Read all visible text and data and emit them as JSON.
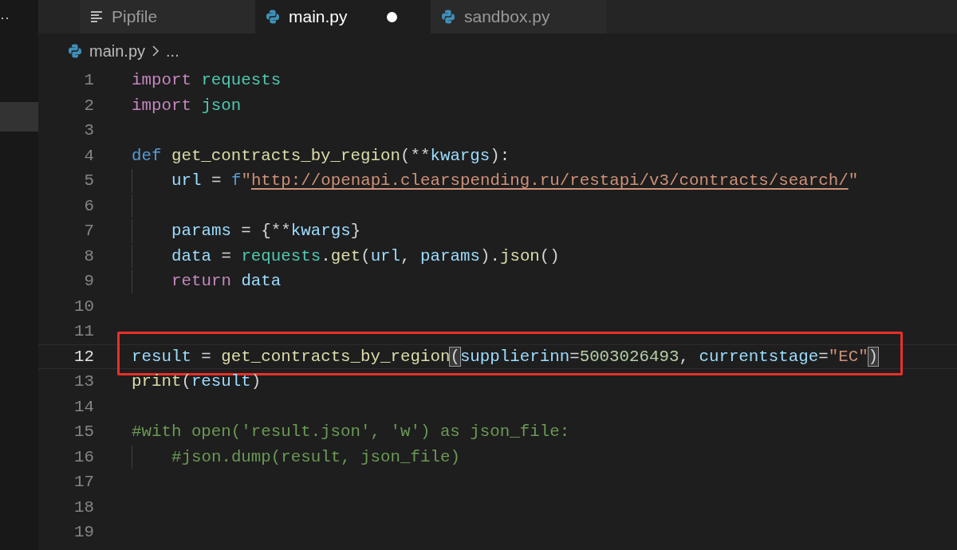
{
  "tab_overflow": "··",
  "tabs": [
    {
      "label": "Pipfile",
      "kind": "text",
      "selected": false,
      "modified": false
    },
    {
      "label": "main.py",
      "kind": "python",
      "selected": true,
      "modified": true
    },
    {
      "label": "sandbox.py",
      "kind": "python",
      "selected": false,
      "modified": false
    }
  ],
  "breadcrumb": {
    "file": "main.py",
    "rest": "..."
  },
  "lines": [
    {
      "number": "1",
      "current": false,
      "boxed": false,
      "indent_guide": false,
      "tokens": [
        {
          "kind": "keyword",
          "text": "import "
        },
        {
          "kind": "module",
          "text": "requests"
        }
      ]
    },
    {
      "number": "2",
      "current": false,
      "boxed": false,
      "indent_guide": false,
      "tokens": [
        {
          "kind": "keyword",
          "text": "import "
        },
        {
          "kind": "module",
          "text": "json"
        }
      ]
    },
    {
      "number": "3",
      "current": false,
      "boxed": false,
      "indent_guide": false
    },
    {
      "number": "4",
      "current": false,
      "boxed": false,
      "indent_guide": false,
      "tokens": [
        {
          "kind": "storage",
          "text": "def "
        },
        {
          "kind": "function",
          "text": "get_contracts_by_region"
        },
        {
          "kind": "plain",
          "text": "(**"
        },
        {
          "kind": "variable",
          "text": "kwargs"
        },
        {
          "kind": "plain",
          "text": "):"
        }
      ]
    },
    {
      "number": "5",
      "current": false,
      "boxed": false,
      "indent_guide": true,
      "tokens": [
        {
          "kind": "variable",
          "text": "url"
        },
        {
          "kind": "plain",
          "text": " = "
        },
        {
          "kind": "storage",
          "text": "f"
        },
        {
          "kind": "string",
          "text": "\""
        },
        {
          "kind": "link",
          "text": "http://openapi.clearspending.ru/restapi/v3/contracts/search/"
        },
        {
          "kind": "string",
          "text": "\""
        }
      ]
    },
    {
      "number": "6",
      "current": false,
      "boxed": false,
      "indent_guide": true
    },
    {
      "number": "7",
      "current": false,
      "boxed": false,
      "indent_guide": true,
      "tokens": [
        {
          "kind": "variable",
          "text": "params"
        },
        {
          "kind": "plain",
          "text": " = {**"
        },
        {
          "kind": "variable",
          "text": "kwargs"
        },
        {
          "kind": "plain",
          "text": "}"
        }
      ]
    },
    {
      "number": "8",
      "current": false,
      "boxed": false,
      "indent_guide": true,
      "tokens": [
        {
          "kind": "variable",
          "text": "data"
        },
        {
          "kind": "plain",
          "text": " = "
        },
        {
          "kind": "module",
          "text": "requests"
        },
        {
          "kind": "plain",
          "text": "."
        },
        {
          "kind": "function",
          "text": "get"
        },
        {
          "kind": "plain",
          "text": "("
        },
        {
          "kind": "variable",
          "text": "url"
        },
        {
          "kind": "plain",
          "text": ", "
        },
        {
          "kind": "variable",
          "text": "params"
        },
        {
          "kind": "plain",
          "text": ")."
        },
        {
          "kind": "function",
          "text": "json"
        },
        {
          "kind": "plain",
          "text": "()"
        }
      ]
    },
    {
      "number": "9",
      "current": false,
      "boxed": false,
      "indent_guide": true,
      "tokens": [
        {
          "kind": "keyword",
          "text": "return "
        },
        {
          "kind": "variable",
          "text": "data"
        }
      ]
    },
    {
      "number": "10",
      "current": false,
      "boxed": false,
      "indent_guide": false
    },
    {
      "number": "11",
      "current": false,
      "boxed": false,
      "indent_guide": false
    },
    {
      "number": "12",
      "current": true,
      "boxed": true,
      "indent_guide": false,
      "tokens": [
        {
          "kind": "variable",
          "text": "result"
        },
        {
          "kind": "plain",
          "text": " = "
        },
        {
          "kind": "function",
          "text": "get_contracts_by_region"
        },
        {
          "kind": "bracket-match",
          "text": "("
        },
        {
          "kind": "variable",
          "text": "supplierinn"
        },
        {
          "kind": "plain",
          "text": "="
        },
        {
          "kind": "number",
          "text": "5003026493"
        },
        {
          "kind": "plain",
          "text": ", "
        },
        {
          "kind": "variable",
          "text": "currentstage"
        },
        {
          "kind": "plain",
          "text": "="
        },
        {
          "kind": "string",
          "text": "\"EC\""
        },
        {
          "kind": "bracket-match",
          "text": ")"
        }
      ]
    },
    {
      "number": "13",
      "current": false,
      "boxed": false,
      "indent_guide": false,
      "tokens": [
        {
          "kind": "function",
          "text": "print"
        },
        {
          "kind": "plain",
          "text": "("
        },
        {
          "kind": "variable",
          "text": "result"
        },
        {
          "kind": "plain",
          "text": ")"
        }
      ]
    },
    {
      "number": "14",
      "current": false,
      "boxed": false,
      "indent_guide": false
    },
    {
      "number": "15",
      "current": false,
      "boxed": false,
      "indent_guide": false,
      "tokens": [
        {
          "kind": "comment",
          "text": "#with open('result.json', 'w') as json_file:"
        }
      ]
    },
    {
      "number": "16",
      "current": false,
      "boxed": false,
      "indent_guide": true,
      "tokens": [
        {
          "kind": "comment",
          "text": "#json.dump(result, json_file)"
        }
      ]
    },
    {
      "number": "17",
      "current": false,
      "boxed": false,
      "indent_guide": false
    },
    {
      "number": "18",
      "current": false,
      "boxed": false,
      "indent_guide": false
    },
    {
      "number": "19",
      "current": false,
      "boxed": false,
      "indent_guide": false
    }
  ]
}
